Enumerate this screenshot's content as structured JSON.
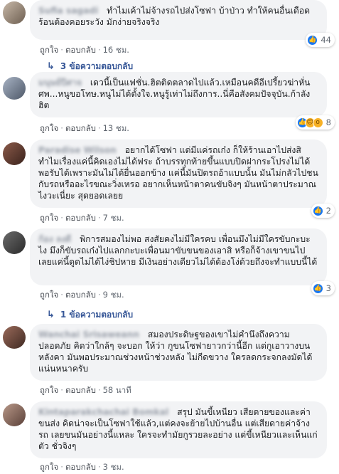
{
  "comments": [
    {
      "author": "Sufia sagadi",
      "text": "ทำไมเค้าไม่จ้างรถไปส่งโซฟา บ้าป่าว ทำให้คนอื่นเดือดร้อนต้องคอยระวัง มักง่ายจริงจริง",
      "like": "ถูกใจ",
      "reply": "ตอบกลับ",
      "time": "16 ชม.",
      "reaction_count": "44",
      "reactions": [
        "like"
      ],
      "replies_label": "3 ข้อความตอบกลับ"
    },
    {
      "author": "มนุษย์ปีศาจ",
      "text": "เดวนี้เป็นแฟชั่น.ฮิตติดตลาดไปแล้ว.เหมือนคดีอีเปรี้ยวฆ่าหั่นศพ...หนูขอโทษ.หนูไม่ได้ตั้งใจ.หนูรู้เท่าไม่ถึงการ..นี่คือสังคมปัจจุบัน.ก้าลังฮิต",
      "like": "ถูกใจ",
      "reply": "ตอบกลับ",
      "time": "13 ชม.",
      "reaction_count": "8",
      "reactions": [
        "like",
        "haha",
        "wow"
      ]
    },
    {
      "author": "Paradise Wilson",
      "text": "อยากได้โซฟา แต่มีแค่รถเก๋ง ก็ให้ร้านเอาไปส่งสิ ทำไมเรื่องแค่นี้คิดเองไม่ได้ฟระ ถ้าบรรทุกท้ายขึ้นแบบปิดฝากระโปรงไม่ได้พอรับได้เพราะมันไม่ได้ยื่นออกข้าง แค่นี้มันปิดรถอ้าแบบนั้น มันไม่กลัวไปชนกับรถหรืออะไรขณะวิ่งเหรอ อยากเห็นหน้าตาคนขับจิงๆ มันหน้าตาประมาณไงวะเนี่ยะ สุดยอดเลยย",
      "like": "ถูกใจ",
      "reply": "ตอบกลับ",
      "time": "7 ชม.",
      "reaction_count": "2",
      "reactions": [
        "like"
      ]
    },
    {
      "author": "ก้อง ลงดี",
      "text": "พิการสมองไม่พอ สงสัยคงไม่มีใครคบ เพื่อนมึงไม่มีใครขับกะบะไง มึงก็ขับรถเก๋งไปแลกกะบะเพื่อนมาขับขนของเอาสิ หรือก็จ้างเขาขนไปเลยแค่นี้ดูดไม่ได้ไง่ชิปหาย มีเงินอย่างเดียวไม่ได้ต้องโง่ด้วยถึงจะทำแบบนี้ได้",
      "like": "ถูกใจ",
      "reply": "ตอบกลับ",
      "time": "9 ชม.",
      "reaction_count": "3",
      "reactions": [
        "like"
      ],
      "replies_label": "1 ข้อความตอบกลับ"
    },
    {
      "author": "Wanchai Srisaweann",
      "text": "สมองประดิษฐของเขาไม่คำนึงถึงความปลอดภัย คิดว่าใกล้ๆ จะบอก ให้ว่า กูขนโซฟายาวกว่านี้อีก แต่กูเอาวางบนหลังคา มันพอประมาณช่วงหน้าช่วงหลัง ไม่กีดขวาง ใครลดกระจกลงมัดได้แน่นหนาครับ",
      "like": "ถูกใจ",
      "reply": "ตอบกลับ",
      "time": "58 นาที"
    },
    {
      "author": "Kintaparakchachai Bomkal",
      "text": "สรุป มันขี้เหนียว เสียดายของและค่าขนส่ง คิดน่าจะเป็นโซฟาใช้แล้ว,แต่คงจะย้ายไปบ้านอื่น แต่เสียดายค่าจ้างรถ เลยขนมันอย่างนี้แหละ ใครจะทำมัยกูรวยละอย่าง แต่ขี้เหนียวและเห็นแก่ตัว ชั่วจิงๆ",
      "like": "ถูกใจ",
      "reply": "ตอบกลับ",
      "time": "3 ชม."
    }
  ],
  "icons": {
    "like": "thumbs-up-icon",
    "haha": "laughing-face-icon",
    "wow": "surprised-face-icon",
    "reply_arrow": "reply-arrow-icon"
  },
  "colors": {
    "link": "#385898",
    "like_blue": "#1877f2",
    "bubble": "#f2f3f5"
  }
}
